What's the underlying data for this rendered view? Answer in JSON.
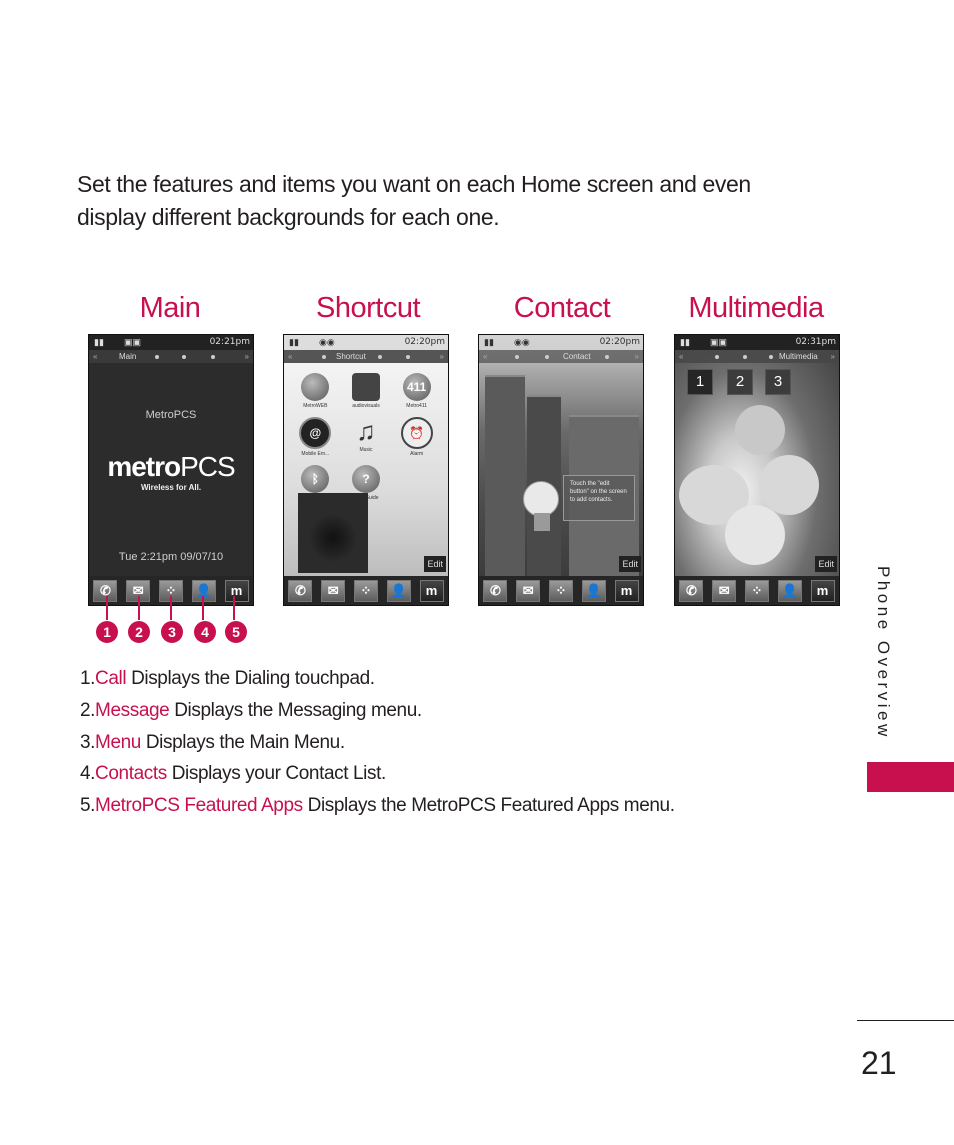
{
  "intro_text": "Set the features and items you want on each Home screen and even display different backgrounds for each one.",
  "accent_color": "#c8104e",
  "screens": [
    {
      "title": "Main",
      "status_time": "02:21",
      "status_ampm": "pm",
      "tab_label": "Main",
      "carrier_label": "MetroPCS",
      "logo_bold": "metro",
      "logo_light": "PCS",
      "logo_tagline": "Wireless for All.",
      "datetime": "Tue 2:21pm 09/07/10"
    },
    {
      "title": "Shortcut",
      "status_time": "02:20",
      "status_ampm": "pm",
      "tab_label": "Shortcut",
      "edit_label": "Edit",
      "shortcuts": [
        {
          "icon": "globe-icon",
          "glyph": "",
          "label": "MetroWEB"
        },
        {
          "icon": "gallery-icon",
          "glyph": "",
          "label": "audiovisuals"
        },
        {
          "icon": "411-icon",
          "glyph": "411",
          "label": "Metro411"
        },
        {
          "icon": "email-icon",
          "glyph": "@",
          "label": "Mobile Em..."
        },
        {
          "icon": "music-note-icon",
          "glyph": "♫",
          "label": "Music"
        },
        {
          "icon": "alarm-clock-icon",
          "glyph": "⏰",
          "label": "Alarm"
        },
        {
          "icon": "bluetooth-icon",
          "glyph": "ᛒ",
          "label": "Bluetooth"
        },
        {
          "icon": "help-icon",
          "glyph": "?",
          "label": "Help Guide"
        }
      ]
    },
    {
      "title": "Contact",
      "status_time": "02:20",
      "status_ampm": "pm",
      "tab_label": "Contact",
      "edit_label": "Edit",
      "tip_text": "Touch the \"edit button\" on the screen to add contacts."
    },
    {
      "title": "Multimedia",
      "status_time": "02:31",
      "status_ampm": "pm",
      "tab_label": "Multimedia",
      "edit_label": "Edit",
      "number_tiles": [
        "1",
        "2",
        "3"
      ]
    }
  ],
  "dock": [
    {
      "icon": "call-icon",
      "glyph": "✆"
    },
    {
      "icon": "message-icon",
      "glyph": "✉"
    },
    {
      "icon": "menu-grid-icon",
      "glyph": "⁘"
    },
    {
      "icon": "contacts-icon",
      "glyph": "👤"
    },
    {
      "icon": "metropcs-apps-icon",
      "glyph": "m"
    }
  ],
  "callouts": [
    "1",
    "2",
    "3",
    "4",
    "5"
  ],
  "legend": [
    {
      "num": "1.",
      "name": "Call",
      "desc": " Displays the Dialing touchpad."
    },
    {
      "num": "2.",
      "name": "Message",
      "desc": " Displays the Messaging menu."
    },
    {
      "num": "3.",
      "name": "Menu",
      "desc": " Displays the Main Menu."
    },
    {
      "num": "4.",
      "name": "Contacts",
      "desc": " Displays your Contact List."
    },
    {
      "num": "5.",
      "name": "MetroPCS Featured Apps",
      "desc": " Displays the MetroPCS Featured Apps menu."
    }
  ],
  "side_label": "Phone Overview",
  "page_number": "21"
}
